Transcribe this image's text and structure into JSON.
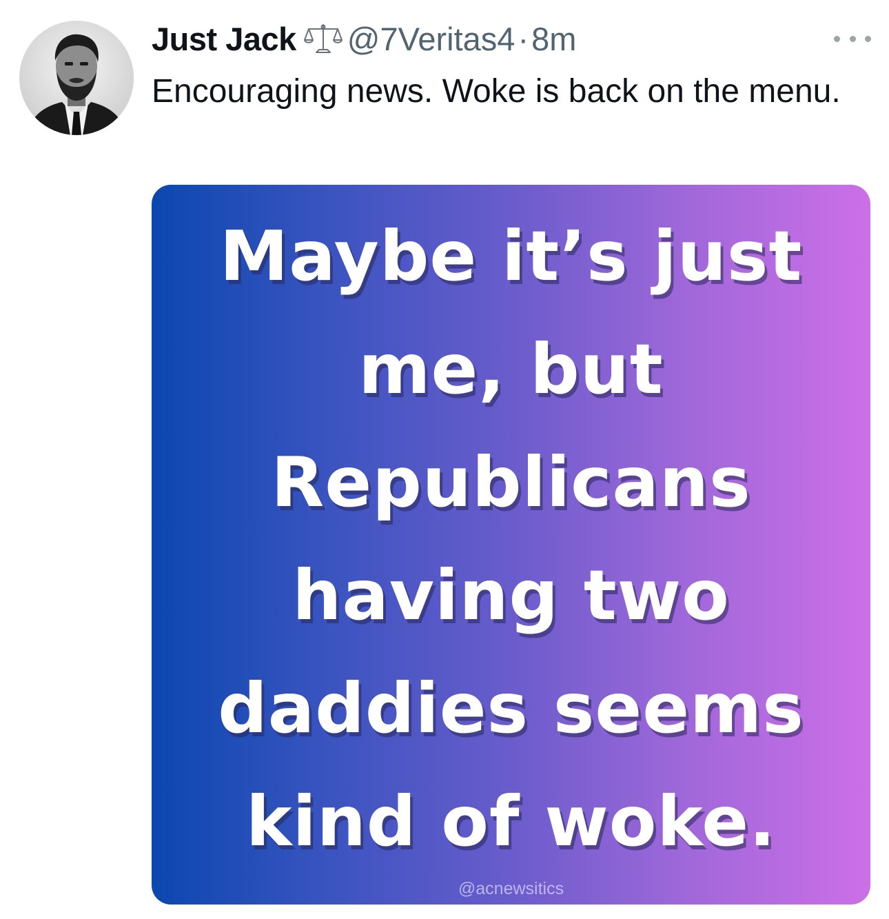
{
  "post": {
    "author": {
      "display_name": "Just Jack",
      "badge_icon": "scales-of-justice-icon",
      "handle": "@7Veritas4",
      "separator": "·",
      "time_ago": "8m"
    },
    "more_icon": "more-horizontal-icon",
    "text": "Encouraging news. Woke is back on the menu.",
    "media": {
      "lines": [
        "Maybe it’s just",
        "me, but",
        "Republicans",
        "having two",
        "daddies seems",
        "kind of woke."
      ],
      "watermark": "@acnewsitics",
      "gradient_start": "#0b47b0",
      "gradient_end": "#cd6fe7"
    }
  },
  "colors": {
    "text_primary": "#0f1419",
    "text_secondary": "#536471",
    "meme_text": "#ffffff"
  }
}
